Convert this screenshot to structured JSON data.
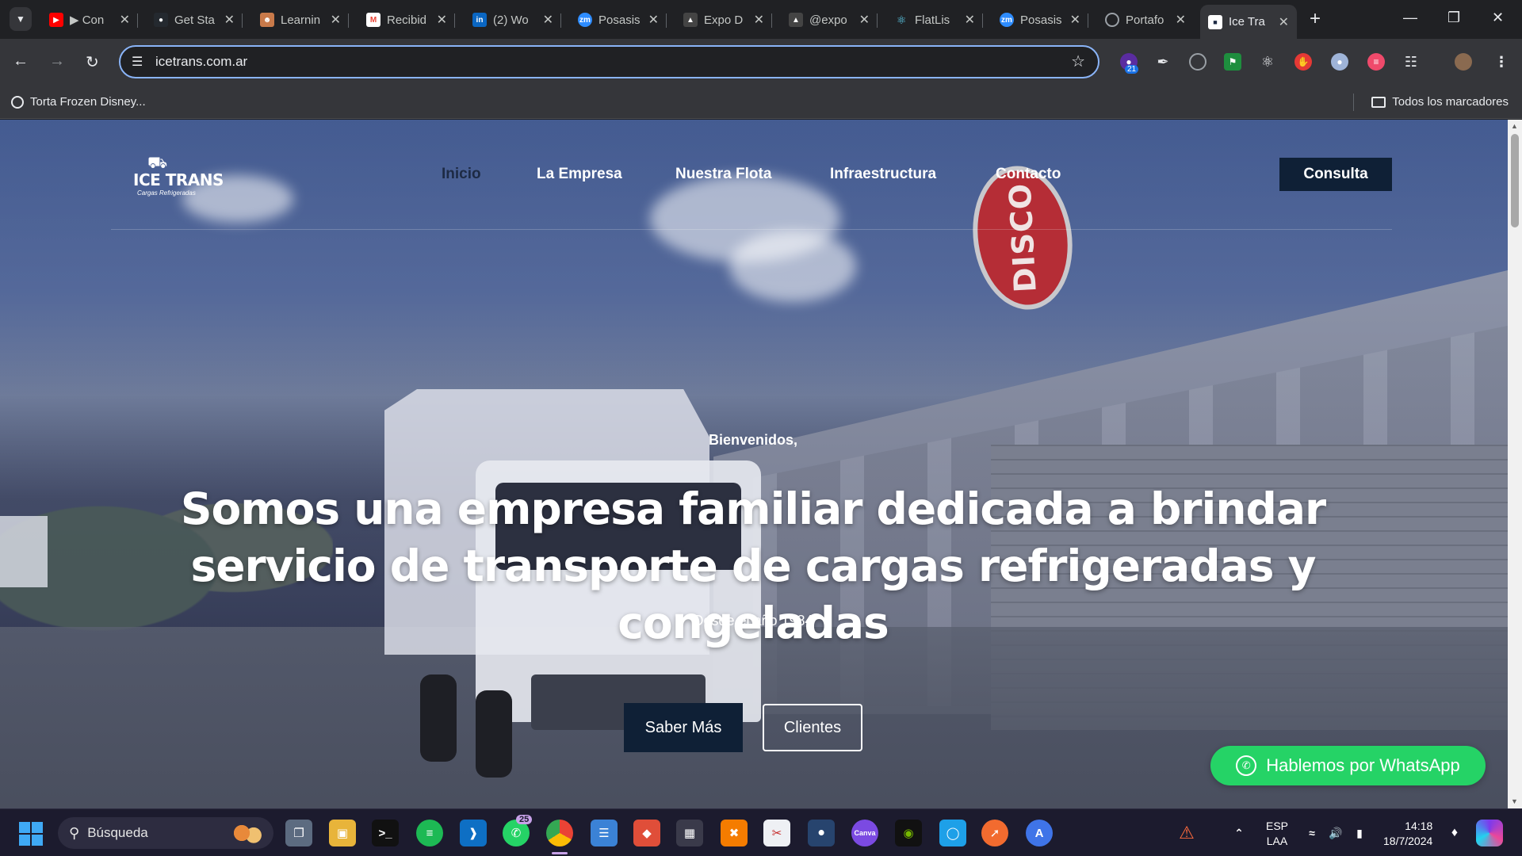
{
  "browser": {
    "tabs": [
      {
        "title": "▶ Con",
        "icon": "youtube-icon",
        "color": "#ff0000"
      },
      {
        "title": "Get Sta",
        "icon": "github-icon",
        "color": "#24292f"
      },
      {
        "title": "Learnin",
        "icon": "coderhouse-icon",
        "color": "#c97a4a"
      },
      {
        "title": "Recibid",
        "icon": "gmail-icon",
        "color": "#ea4335"
      },
      {
        "title": "(2) Wo",
        "icon": "linkedin-icon",
        "color": "#0a66c2"
      },
      {
        "title": "Posasis",
        "icon": "zoom-icon",
        "color": "#2d8cff"
      },
      {
        "title": "Expo D",
        "icon": "expo-icon",
        "color": "#444444"
      },
      {
        "title": "@expo",
        "icon": "expo-icon",
        "color": "#444444"
      },
      {
        "title": "FlatLis",
        "icon": "react-icon",
        "color": "#61dafb"
      },
      {
        "title": "Posasis",
        "icon": "zoom-icon",
        "color": "#2d8cff"
      },
      {
        "title": "Portafo",
        "icon": "globe-icon",
        "color": "#9aa0a6"
      },
      {
        "title": "Ice Tra",
        "icon": "ice-trans-favicon",
        "color": "#ffffff"
      }
    ],
    "url": "icetrans.com.ar",
    "extensions_badge": "21",
    "bookmarks": {
      "item": "Torta Frozen Disney...",
      "all": "Todos los marcadores"
    }
  },
  "site": {
    "logo": {
      "brand": "ICE TRANS",
      "tagline": "Cargas Refrigeradas"
    },
    "nav": [
      "Inicio",
      "La Empresa",
      "Nuestra Flota",
      "Infraestructura",
      "Contacto"
    ],
    "nav_active": "Inicio",
    "cta": "Consulta",
    "hero": {
      "welcome": "Bienvenidos,",
      "title": "Somos una empresa familiar dedicada a brindar servicio de transporte de cargas refrigeradas y congeladas",
      "subtitle": "Desde el año 1984",
      "btn_primary": "Saber Más",
      "btn_secondary": "Clientes"
    },
    "whatsapp": "Hablemos por WhatsApp",
    "sign_text": "DISCO"
  },
  "taskbar": {
    "search_placeholder": "Búsqueda",
    "whatsapp_badge": "25",
    "lang_top": "ESP",
    "lang_bottom": "LAA",
    "time": "14:18",
    "date": "18/7/2024"
  },
  "colors": {
    "accent_navy": "#0f2036",
    "whatsapp_green": "#25d366",
    "omnibox_focus": "#8ab4f8"
  }
}
